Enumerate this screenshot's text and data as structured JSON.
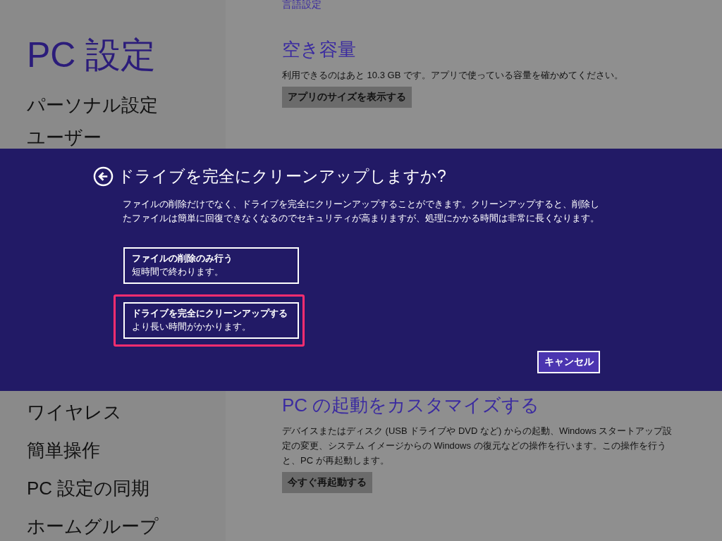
{
  "sidebar": {
    "title": "PC 設定",
    "items_top": [
      "パーソナル設定",
      "ユーザー"
    ],
    "items_bottom": [
      "ワイヤレス",
      "簡単操作",
      "PC 設定の同期",
      "ホームグループ"
    ]
  },
  "content": {
    "top_link": "言語設定",
    "sections": [
      {
        "heading": "空き容量",
        "text": "利用できるのはあと 10.3 GB です。アプリで使っている容量を確かめてください。",
        "button": "アプリのサイズを表示する"
      },
      {
        "heading": "PC の起動をカスタマイズする",
        "text": "デバイスまたはディスク (USB ドライブや DVD など) からの起動、Windows スタートアップ設定の変更、システム イメージからの Windows の復元などの操作を行います。この操作を行うと、PC が再起動します。",
        "button": "今すぐ再起動する"
      }
    ]
  },
  "dialog": {
    "title": "ドライブを完全にクリーンアップしますか?",
    "text": "ファイルの削除だけでなく、ドライブを完全にクリーンアップすることができます。クリーンアップすると、削除したファイルは簡単に回復できなくなるのでセキュリティが高まりますが、処理にかかる時間は非常に長くなります。",
    "options": [
      {
        "title": "ファイルの削除のみ行う",
        "subtitle": "短時間で終わります。",
        "highlighted": false
      },
      {
        "title": "ドライブを完全にクリーンアップする",
        "subtitle": "より長い時間がかかります。",
        "highlighted": true
      }
    ],
    "cancel": "キャンセル"
  }
}
